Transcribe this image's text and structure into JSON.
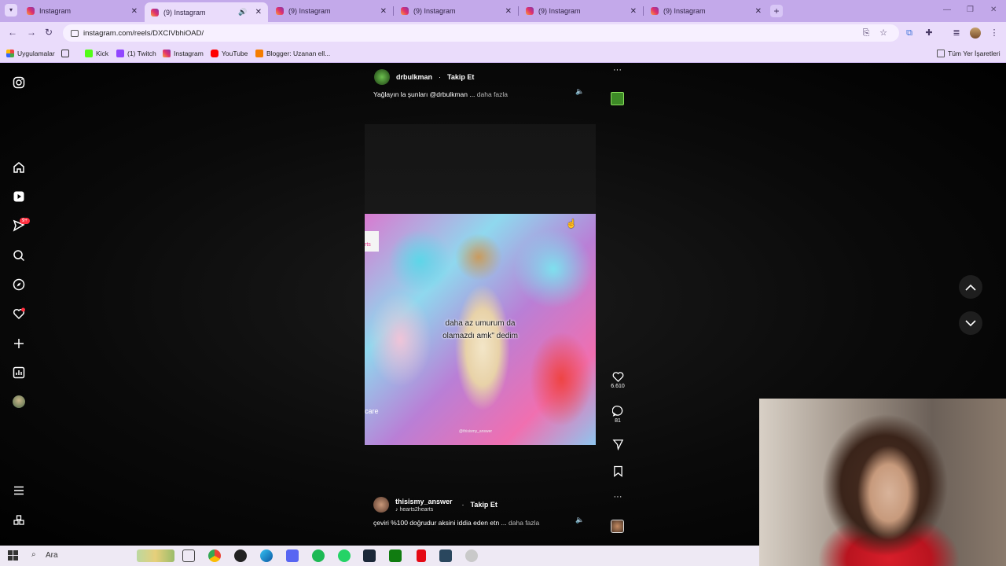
{
  "browser": {
    "tabs": [
      {
        "label": "Instagram",
        "active": false
      },
      {
        "label": "(9) Instagram",
        "active": true,
        "audio": true
      },
      {
        "label": "(9) Instagram",
        "active": false
      },
      {
        "label": "(9) Instagram",
        "active": false
      },
      {
        "label": "(9) Instagram",
        "active": false
      },
      {
        "label": "(9) Instagram",
        "active": false
      }
    ],
    "url": "instagram.com/reels/DXCIVbhiOAD/",
    "bookmarks": [
      {
        "label": "Uygulamalar",
        "icon": "apps-grid-icon"
      },
      {
        "label": "Kick",
        "icon": "kick-icon",
        "color": "#53fc18"
      },
      {
        "label": "(1) Twitch",
        "icon": "twitch-icon",
        "color": "#9146ff"
      },
      {
        "label": "Instagram",
        "icon": "instagram-icon"
      },
      {
        "label": "YouTube",
        "icon": "youtube-icon",
        "color": "#ff0000"
      },
      {
        "label": "Blogger: Uzanan ell...",
        "icon": "blogger-icon",
        "color": "#f57d00"
      }
    ],
    "all_bookmarks_label": "Tüm Yer İşaretleri"
  },
  "left_nav": {
    "notifications_badge": "9+",
    "items": [
      "instagram-logo-icon",
      "home-icon",
      "reels-icon",
      "messages-icon",
      "search-icon",
      "explore-icon",
      "notifications-icon",
      "create-icon",
      "dashboard-icon",
      "profile-avatar",
      "more-menu-icon",
      "also-from-meta-icon"
    ]
  },
  "reel_top": {
    "username": "drbulkman",
    "follow_label": "Takip Et",
    "caption": "Yağlayın la şunları @drbulkman ...",
    "more_label": "daha fazla"
  },
  "reel_main": {
    "video_caption_line1": "daha az umurum da",
    "video_caption_line2": "olamazdı amk\" dedim",
    "video_care_text": "care",
    "watermark": "@thisismy_answer",
    "username": "thisismy_answer",
    "audio_label": "hearts2hearts",
    "follow_label": "Takip Et",
    "caption": "çeviri %100 doğrudur aksini iddia eden etn ...",
    "more_label": "daha fazla",
    "likes": "6.610",
    "comments": "81"
  },
  "taskbar": {
    "search_label": "Ara"
  },
  "colors": {
    "tab_bar": "#c3a9ea",
    "toolbar": "#eadcfb",
    "badge": "#ff3040",
    "page_bg": "#000000"
  }
}
